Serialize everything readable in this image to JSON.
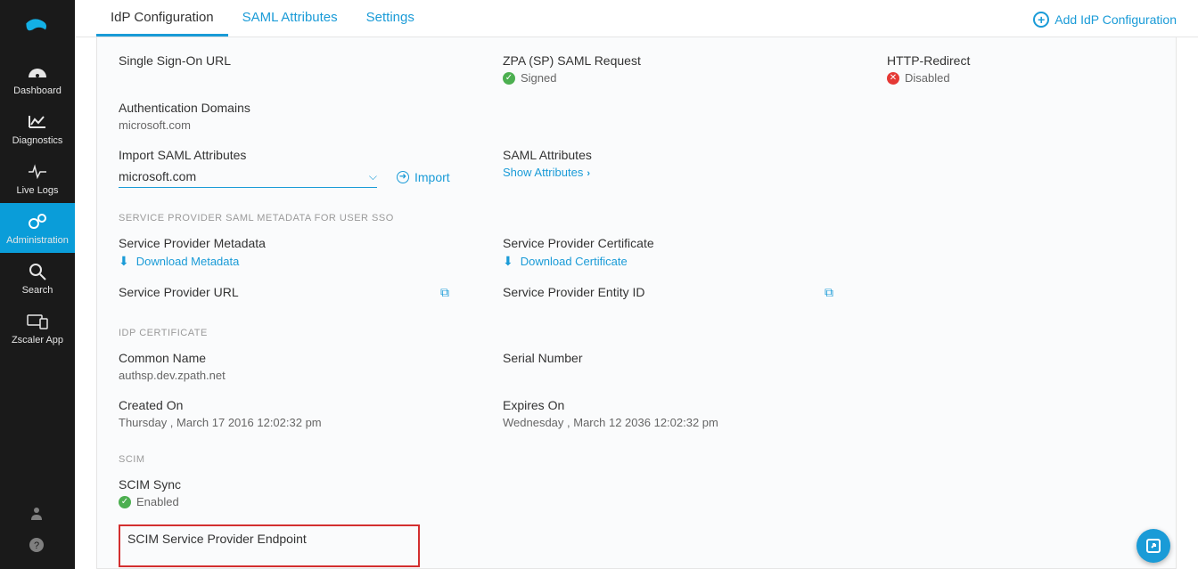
{
  "sidebar": {
    "items": [
      {
        "label": "Dashboard"
      },
      {
        "label": "Diagnostics"
      },
      {
        "label": "Live Logs"
      },
      {
        "label": "Administration"
      },
      {
        "label": "Search"
      },
      {
        "label": "Zscaler App"
      }
    ]
  },
  "tabs": {
    "idp": "IdP Configuration",
    "saml": "SAML Attributes",
    "settings": "Settings"
  },
  "add_config": "Add IdP Configuration",
  "fields": {
    "sso_url_label": "Single Sign-On URL",
    "zpa_request_label": "ZPA (SP) SAML Request",
    "zpa_request_status": "Signed",
    "http_redirect_label": "HTTP-Redirect",
    "http_redirect_status": "Disabled",
    "auth_domains_label": "Authentication Domains",
    "auth_domains_value": "microsoft.com",
    "import_saml_label": "Import SAML Attributes",
    "import_select_value": "microsoft.com",
    "import_link": "Import",
    "saml_attr_label": "SAML Attributes",
    "show_attr_link": "Show Attributes",
    "section_sp": "SERVICE PROVIDER SAML METADATA FOR USER SSO",
    "sp_metadata_label": "Service Provider Metadata",
    "sp_metadata_link": "Download Metadata",
    "sp_cert_label": "Service Provider Certificate",
    "sp_cert_link": "Download Certificate",
    "sp_url_label": "Service Provider URL",
    "sp_entity_label": "Service Provider Entity ID",
    "section_idp_cert": "IdP CERTIFICATE",
    "common_name_label": "Common Name",
    "common_name_value": "authsp.dev.zpath.net",
    "serial_label": "Serial Number",
    "created_label": "Created On",
    "created_value": "Thursday , March 17 2016 12:02:32 pm",
    "expires_label": "Expires On",
    "expires_value": "Wednesday , March 12 2036 12:02:32 pm",
    "section_scim": "SCIM",
    "scim_sync_label": "SCIM Sync",
    "scim_sync_status": "Enabled",
    "scim_endpoint_label": "SCIM Service Provider Endpoint"
  }
}
